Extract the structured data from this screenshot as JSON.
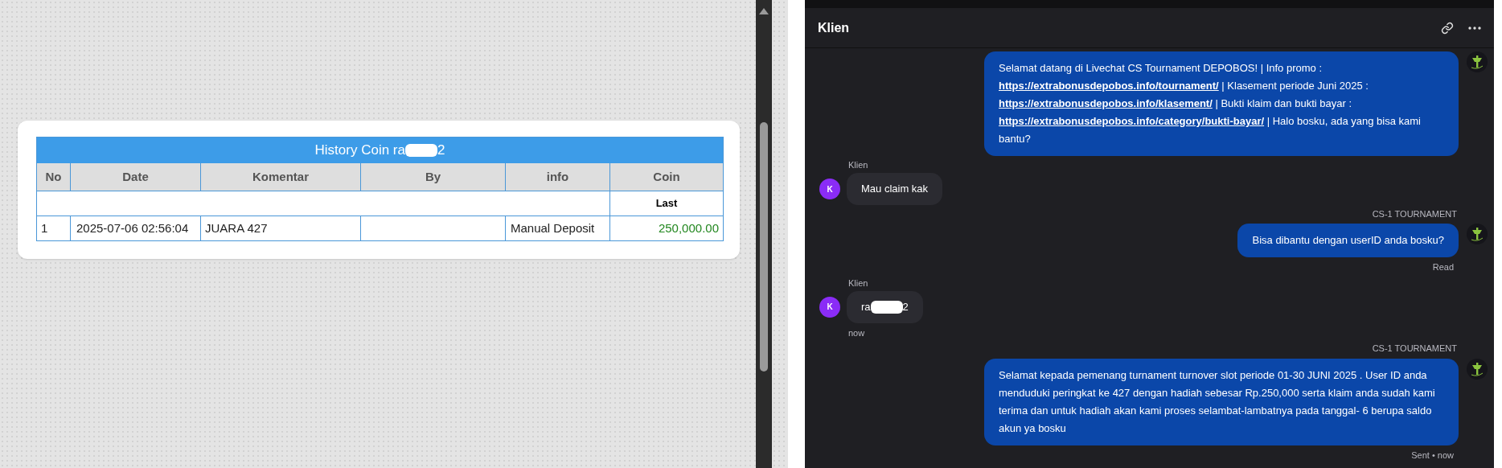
{
  "history_card": {
    "title_prefix": "History Coin ra",
    "title_suffix": "2",
    "columns": [
      "No",
      "Date",
      "Komentar",
      "By",
      "info",
      "Coin"
    ],
    "subheader": "Last",
    "rows": [
      {
        "no": "1",
        "date": "2025-07-06 02:56:04",
        "komentar": "JUARA 427",
        "info": "Manual Deposit",
        "coin": "250,000.00"
      }
    ]
  },
  "chat": {
    "title": "Klien",
    "messages": [
      {
        "kind": "agent",
        "parts": [
          {
            "kind": "text",
            "text": "Selamat datang di Livechat CS Tournament DEPOBOS! | Info promo : "
          },
          {
            "kind": "link",
            "text": "https://extrabonusdepobos.info/tournament/"
          },
          {
            "kind": "text",
            "text": " | Klasement periode Juni 2025 : "
          },
          {
            "kind": "link",
            "text": "https://extrabonusdepobos.info/klasement/"
          },
          {
            "kind": "text",
            "text": " | Bukti klaim dan bukti bayar : "
          },
          {
            "kind": "link",
            "text": "https://extrabonusdepobos.info/category/bukti-bayar/"
          },
          {
            "kind": "text",
            "text": " | Halo bosku, ada yang bisa kami bantu?"
          }
        ]
      },
      {
        "kind": "client",
        "sender": "Klien",
        "avatar": "K",
        "parts": [
          {
            "kind": "text",
            "text": "Mau claim kak"
          }
        ]
      },
      {
        "kind": "agent",
        "sender": "CS-1 TOURNAMENT",
        "status": "Read",
        "parts": [
          {
            "kind": "text",
            "text": "Bisa dibantu dengan userID anda bosku?"
          }
        ]
      },
      {
        "kind": "client",
        "sender": "Klien",
        "avatar": "K",
        "status": "now",
        "parts": [
          {
            "kind": "text",
            "text": "ra"
          },
          {
            "kind": "redaction"
          },
          {
            "kind": "text",
            "text": "2"
          }
        ]
      },
      {
        "kind": "agent",
        "sender": "CS-1 TOURNAMENT",
        "status": "Sent • now",
        "parts": [
          {
            "kind": "text",
            "text": "Selamat kepada pemenang turnament turnover slot periode 01-30 JUNI 2025 . User ID anda menduduki peringkat ke 427 dengan hadiah sebesar Rp.250,000 serta klaim anda sudah kami terima dan untuk hadiah akan kami proses selambat-lambatnya pada tanggal- 6 berupa saldo akun ya bosku"
          }
        ]
      }
    ]
  }
}
